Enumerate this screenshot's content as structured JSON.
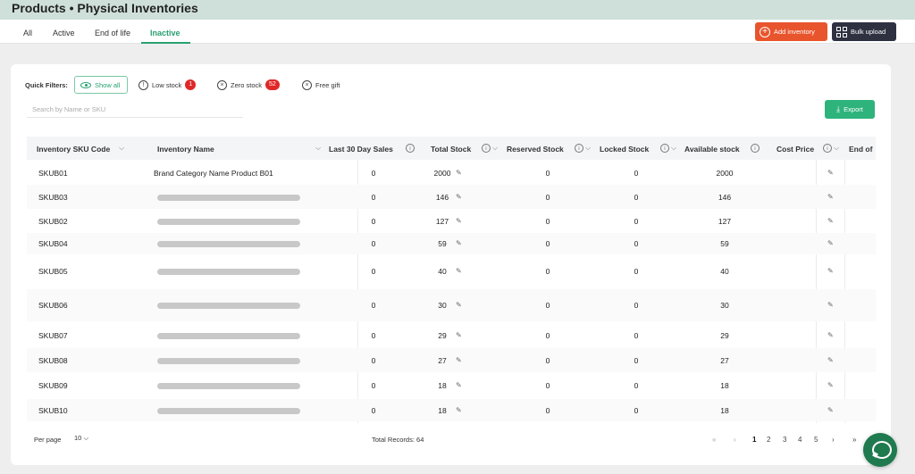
{
  "header": {
    "title": "Products • Physical Inventories"
  },
  "tabs": [
    {
      "label": "All"
    },
    {
      "label": "Active"
    },
    {
      "label": "End of life"
    },
    {
      "label": "Inactive",
      "active": true
    }
  ],
  "actions": {
    "add_inventory": "Add inventory",
    "bulk_upload": "Bulk upload",
    "export": "Export"
  },
  "filters": {
    "label": "Quick Filters:",
    "show_all": "Show all",
    "low_stock": "Low stock",
    "low_stock_count": "1",
    "zero_stock": "Zero stock",
    "zero_stock_count": "52",
    "free_gift": "Free gift"
  },
  "search": {
    "placeholder": "Search by Name or SKU",
    "value": ""
  },
  "columns": {
    "sku": "Inventory SKU Code",
    "name": "Inventory Name",
    "sales30": "Last 30 Day Sales",
    "total": "Total Stock",
    "reserved": "Reserved Stock",
    "locked": "Locked Stock",
    "available": "Available stock",
    "cost": "Cost Price",
    "eol": "End of"
  },
  "rows": [
    {
      "sku": "SKUB01",
      "name": "Brand Category Name Product B01",
      "sales30": "0",
      "total": "2000",
      "reserved": "0",
      "locked": "0",
      "available": "2000"
    },
    {
      "sku": "SKUB03",
      "name": "",
      "sales30": "0",
      "total": "146",
      "reserved": "0",
      "locked": "0",
      "available": "146"
    },
    {
      "sku": "SKUB02",
      "name": "",
      "sales30": "0",
      "total": "127",
      "reserved": "0",
      "locked": "0",
      "available": "127"
    },
    {
      "sku": "SKUB04",
      "name": "",
      "sales30": "0",
      "total": "59",
      "reserved": "0",
      "locked": "0",
      "available": "59"
    },
    {
      "sku": "SKUB05",
      "name": "",
      "sales30": "0",
      "total": "40",
      "reserved": "0",
      "locked": "0",
      "available": "40"
    },
    {
      "sku": "SKUB06",
      "name": "",
      "sales30": "0",
      "total": "30",
      "reserved": "0",
      "locked": "0",
      "available": "30"
    },
    {
      "sku": "SKUB07",
      "name": "",
      "sales30": "0",
      "total": "29",
      "reserved": "0",
      "locked": "0",
      "available": "29"
    },
    {
      "sku": "SKUB08",
      "name": "",
      "sales30": "0",
      "total": "27",
      "reserved": "0",
      "locked": "0",
      "available": "27"
    },
    {
      "sku": "SKUB09",
      "name": "",
      "sales30": "0",
      "total": "18",
      "reserved": "0",
      "locked": "0",
      "available": "18"
    },
    {
      "sku": "SKUB10",
      "name": "",
      "sales30": "0",
      "total": "18",
      "reserved": "0",
      "locked": "0",
      "available": "18"
    }
  ],
  "footer": {
    "per_page_label": "Per page",
    "per_page_value": "10",
    "total_records": "Total Records:  64",
    "pages": [
      "1",
      "2",
      "3",
      "4",
      "5"
    ],
    "current_page": "1"
  },
  "icons": [
    "plus-circle-icon",
    "grid-icon",
    "eye-icon",
    "info-icon",
    "close-circle-icon",
    "download-icon",
    "edit-icon",
    "chevron-down-icon",
    "chat-icon"
  ],
  "colors": {
    "accent": "#27a06f",
    "add_button": "#e8542c",
    "bulk_button": "#2d3140",
    "badge": "#e02828",
    "header_band": "#cfe0da",
    "chat": "#207a4f"
  }
}
